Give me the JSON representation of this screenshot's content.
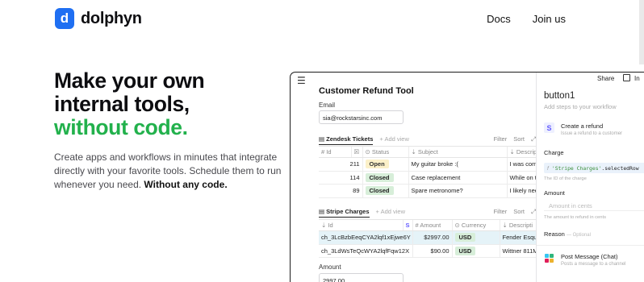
{
  "brand": {
    "logo_letter": "d",
    "name": "dolphyn",
    "color": "#1f6ff2"
  },
  "nav": {
    "docs": "Docs",
    "join": "Join us"
  },
  "hero": {
    "line1": "Make your own",
    "line2": "internal tools,",
    "line3": "without code.",
    "desc": "Create apps and workflows in minutes that integrate directly with your favorite tools. Schedule them to run whenever you need.",
    "desc_bold": "Without any code.",
    "accent": "#22b14c"
  },
  "app": {
    "menu_icon": "hamburger-icon",
    "title": "Customer Refund Tool",
    "email_label": "Email",
    "email_value": "sia@rockstarsinc.com",
    "zendesk": {
      "name": "Zendesk Tickets",
      "add_view": "+ Add view",
      "filter": "Filter",
      "sort": "Sort",
      "columns": [
        "Id",
        "",
        "Status",
        "Subject",
        "Descripti"
      ],
      "rows": [
        {
          "id": "211",
          "status": "Open",
          "subject": "My guitar broke :(",
          "desc": "I was comp"
        },
        {
          "id": "114",
          "status": "Closed",
          "subject": "Case replacement",
          "desc": "While on to"
        },
        {
          "id": "89",
          "status": "Closed",
          "subject": "Spare metronome?",
          "desc": "I likely nee"
        }
      ]
    },
    "stripe": {
      "name": "Stripe Charges",
      "add_view": "+ Add view",
      "filter": "Filter",
      "sort": "Sort",
      "columns": [
        "Id",
        "",
        "Amount",
        "Currency",
        "Descripti"
      ],
      "rows": [
        {
          "id": "ch_3LcBzbEeqCYA2lqf1xEjwe6Y",
          "amount": "$2997.00",
          "currency": "USD",
          "desc": "Fender Esqu"
        },
        {
          "id": "ch_3LdWsTeQcWYA2lqfFqw12X",
          "amount": "$90.00",
          "currency": "USD",
          "desc": "Wittner 811M"
        }
      ]
    },
    "amount_label": "Amount",
    "amount_value": "2997.00"
  },
  "panel": {
    "share": "Share",
    "inspect": "In",
    "title": "button1",
    "subtitle": "Add steps to your workflow",
    "step1_title": "Create a refund",
    "step1_sub": "Issue a refund to a customer",
    "charge_label": "Charge",
    "charge_code_pre": "'Stripe Charges'",
    "charge_code_post": ".selectedRow",
    "charge_hint": "The ID of the charge",
    "amount_label": "Amount",
    "amount_placeholder": "Amount in cents",
    "amount_hint": "The amount to refund in cents",
    "reason_label": "Reason",
    "reason_optional": "— Optional",
    "step2_title": "Post Message (Chat)",
    "step2_sub": "Posts a message to a channel"
  }
}
